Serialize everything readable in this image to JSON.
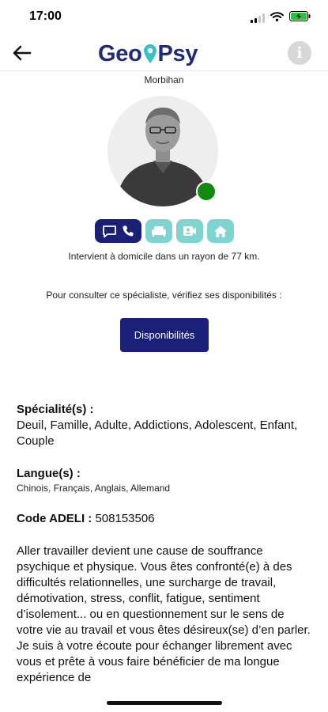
{
  "status_bar": {
    "time": "17:00"
  },
  "header": {
    "logo_left": "Geo",
    "logo_right": "Psy",
    "info_glyph": "i",
    "brand_color": "#1e2a7c",
    "accent_color": "#38c1c5"
  },
  "profile": {
    "region": "Morbihan",
    "online_status_color": "#118a11",
    "consultation_modes": [
      {
        "name": "chat-phone",
        "icons": [
          "chat-icon",
          "phone-icon"
        ],
        "active": true
      },
      {
        "name": "cabinet",
        "icons": [
          "sofa-icon"
        ],
        "active": false
      },
      {
        "name": "video",
        "icons": [
          "video-icon"
        ],
        "active": false
      },
      {
        "name": "home",
        "icons": [
          "home-icon"
        ],
        "active": false
      }
    ],
    "radius_text": "Intervient à domicile dans un rayon de 77 km.",
    "consult_text": "Pour consulter ce spécialiste, vérifiez ses disponibilités :",
    "availability_button": "Disponibilités"
  },
  "details": {
    "specialities_title": "Spécialité(s) :",
    "specialities": "Deuil, Famille, Adulte, Addictions, Adolescent, Enfant, Couple",
    "languages_title": "Langue(s) :",
    "languages": "Chinois, Français, Anglais, Allemand",
    "adeli_label": "Code ADELI :",
    "adeli_value": "508153506",
    "description": "Aller travailler devient une cause de souffrance psychique et physique. Vous êtes confronté(e) à des difficultés relationnelles, une surcharge de travail, démotivation, stress, conflit, fatigue, sentiment d’isolement... ou en questionnement sur le sens de votre vie au travail et vous êtes désireux(se) d’en parler. Je suis à votre écoute pour échanger librement avec vous et prête à vous faire bénéficier de ma longue expérience de"
  }
}
